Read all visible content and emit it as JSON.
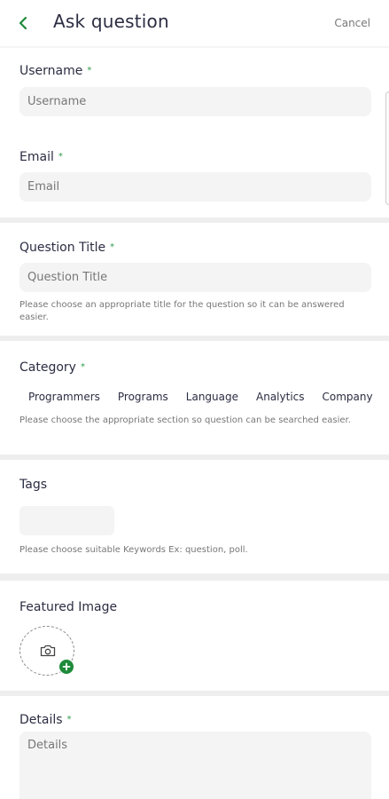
{
  "header": {
    "title": "Ask question",
    "cancel_label": "Cancel"
  },
  "form": {
    "username": {
      "label": "Username",
      "placeholder": "Username",
      "required_mark": "*"
    },
    "email": {
      "label": "Email",
      "placeholder": "Email",
      "required_mark": "*"
    },
    "question_title": {
      "label": "Question Title",
      "placeholder": "Question Title",
      "required_mark": "*",
      "help": "Please choose an appropriate title for the question so it can be answered easier."
    },
    "category": {
      "label": "Category",
      "required_mark": "*",
      "options": [
        "Programmers",
        "Programs",
        "Language",
        "Analytics",
        "Company"
      ],
      "help": "Please choose the appropriate section so question can be searched easier."
    },
    "tags": {
      "label": "Tags",
      "help": "Please choose suitable Keywords Ex: question, poll."
    },
    "featured_image": {
      "label": "Featured Image"
    },
    "details": {
      "label": "Details",
      "placeholder": "Details",
      "required_mark": "*"
    }
  },
  "colors": {
    "accent": "#1f8a3a",
    "input_bg": "#f4f4f4",
    "divider": "#eeeeee"
  },
  "icons": {
    "back": "chevron-left-icon",
    "camera": "camera-icon",
    "add": "plus-icon"
  }
}
